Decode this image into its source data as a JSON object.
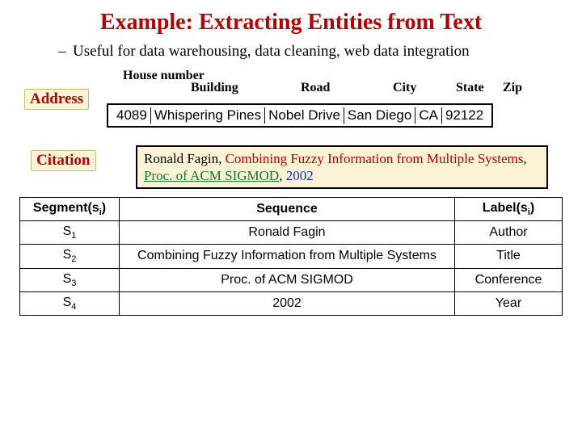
{
  "title": "Example: Extracting Entities from Text",
  "bullet": "Useful for data warehousing, data cleaning, web data integration",
  "address": {
    "tag": "Address",
    "headers": [
      "House number",
      "Building",
      "Road",
      "City",
      "State",
      "Zip"
    ],
    "values": [
      "4089",
      "Whispering Pines",
      "Nobel Drive",
      "San Diego",
      "CA",
      "92122"
    ]
  },
  "citation": {
    "tag": "Citation",
    "author": "Ronald Fagin",
    "title": "Combining Fuzzy Information from Multiple Systems",
    "conf": "Proc. of ACM SIGMOD",
    "year": "2002"
  },
  "table": {
    "head": {
      "seg": "Segment(s",
      "segsub": "i",
      "segclose": ")",
      "seq": "Sequence",
      "lab": "Label(s",
      "labsub": "i",
      "labclose": ")"
    },
    "rows": [
      {
        "s": "S",
        "i": "1",
        "seq": "Ronald Fagin",
        "lab": "Author"
      },
      {
        "s": "S",
        "i": "2",
        "seq": "Combining Fuzzy Information from Multiple Systems",
        "lab": "Title"
      },
      {
        "s": "S",
        "i": "3",
        "seq": "Proc. of ACM SIGMOD",
        "lab": "Conference"
      },
      {
        "s": "S",
        "i": "4",
        "seq": "2002",
        "lab": "Year"
      }
    ]
  }
}
